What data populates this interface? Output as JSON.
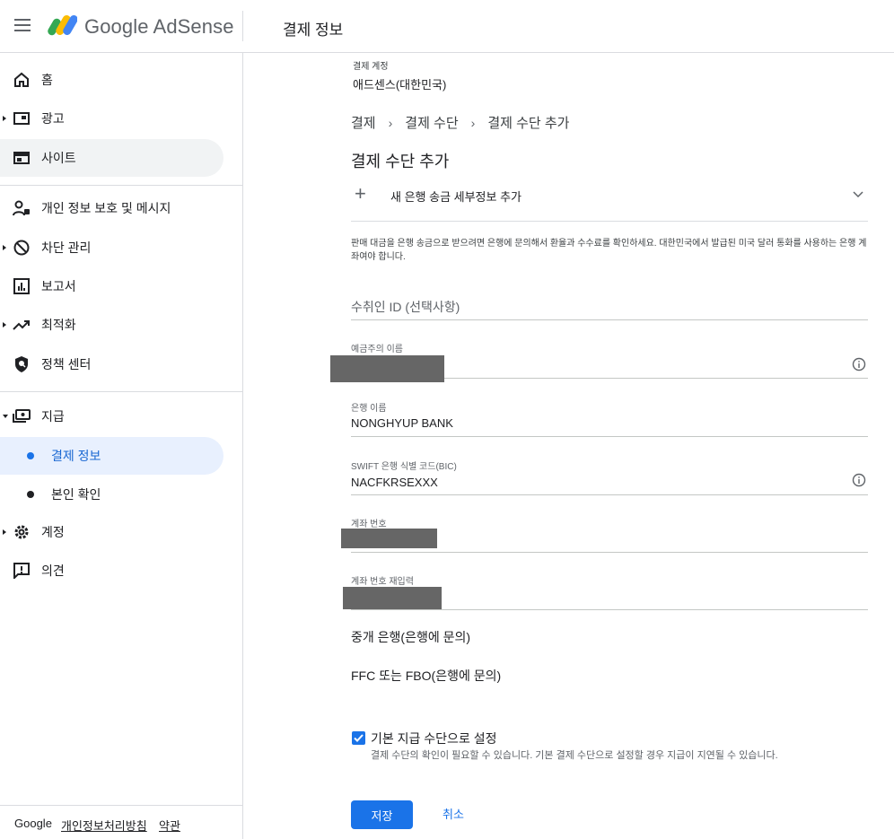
{
  "app": {
    "brand": "Google AdSense",
    "page_title": "결제 정보"
  },
  "sidebar": {
    "items": [
      {
        "label": "홈",
        "icon": "home-icon"
      },
      {
        "label": "광고",
        "icon": "ad-icon"
      },
      {
        "label": "사이트",
        "icon": "sites-icon"
      },
      {
        "label": "개인 정보 보호 및 메시지",
        "icon": "privacy-messaging-icon"
      },
      {
        "label": "차단 관리",
        "icon": "block-icon"
      },
      {
        "label": "보고서",
        "icon": "reports-icon"
      },
      {
        "label": "최적화",
        "icon": "optimization-icon"
      },
      {
        "label": "정책 센터",
        "icon": "policy-shield-icon"
      },
      {
        "label": "지급",
        "icon": "payments-icon"
      },
      {
        "label": "결제 정보",
        "icon": "dot"
      },
      {
        "label": "본인 확인",
        "icon": "dot"
      },
      {
        "label": "계정",
        "icon": "gear-icon"
      },
      {
        "label": "의견",
        "icon": "feedback-icon"
      }
    ],
    "footer": {
      "google": "Google",
      "privacy": "개인정보처리방침",
      "terms": "약관"
    }
  },
  "account": {
    "label": "결제 계정",
    "value": "애드센스(대한민국)"
  },
  "breadcrumb": [
    "결제",
    "결제 수단",
    "결제 수단 추가"
  ],
  "section_title": "결제 수단 추가",
  "expander": {
    "label": "새 은행 송금 세부정보 추가"
  },
  "note": "판매 대금을 은행 송금으로 받으려면 은행에 문의해서 환율과 수수료를 확인하세요. 대한민국에서 발급된 미국 달러 통화를 사용하는 은행 계좌여야 합니다.",
  "form": {
    "payee_id": {
      "placeholder": "수취인 ID (선택사항)"
    },
    "account_holder": {
      "label": "예금주의 이름",
      "value": ""
    },
    "bank_name": {
      "label": "은행 이름",
      "value": "NONGHYUP BANK"
    },
    "swift": {
      "label": "SWIFT 은행 식별 코드(BIC)",
      "value": "NACFKRSEXXX"
    },
    "account_number": {
      "label": "계좌 번호",
      "value": ""
    },
    "account_number_confirm": {
      "label": "계좌 번호 재입력",
      "value": ""
    },
    "intermediary_bank": "중개 은행(은행에 문의)",
    "ffc": "FFC 또는 FBO(은행에 문의)",
    "default_checkbox": {
      "label": "기본 지급 수단으로 설정",
      "help": "결제 수단의 확인이 필요할 수 있습니다. 기본 결제 수단으로 설정할 경우 지급이 지연될 수 있습니다.",
      "checked": true
    }
  },
  "actions": {
    "save": "저장",
    "cancel": "취소"
  },
  "colors": {
    "accent": "#1a73e8",
    "active_nav_bg": "#e8f0fe",
    "redaction": "#666666"
  }
}
